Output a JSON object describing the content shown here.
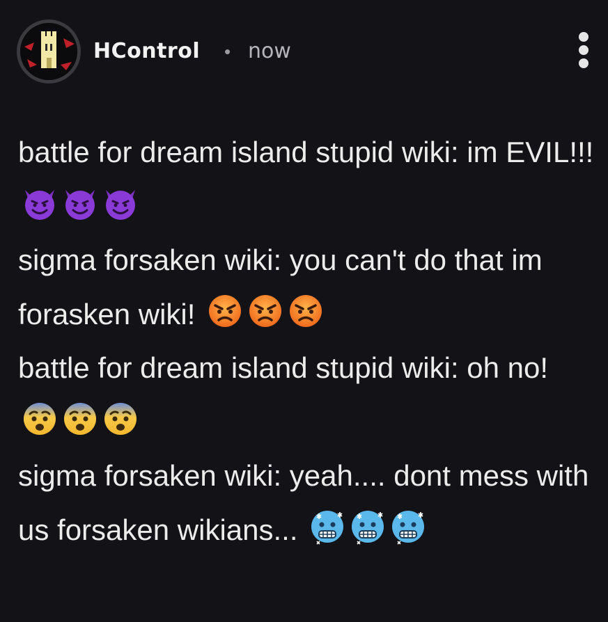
{
  "post": {
    "author": "HControl",
    "separator": "•",
    "time": "now",
    "avatar_icon": "castle-tower-icon",
    "menu_icon": "more-vertical-icon"
  },
  "content": {
    "lines": [
      {
        "text": "battle for dream island stupid wiki: im EVIL!!!",
        "emoji": "smiling-devil-emoji",
        "emoji_count": 3
      },
      {
        "text": "sigma forsaken wiki: you can't do that im forasken wiki!",
        "emoji": "angry-face-emoji",
        "emoji_count": 3
      },
      {
        "text": "battle for dream island stupid wiki: oh no!",
        "emoji": "fearful-face-emoji",
        "emoji_count": 3
      },
      {
        "text": "sigma forsaken wiki: yeah.... dont mess with us forsaken wikians...",
        "emoji": "cold-face-emoji",
        "emoji_count": 3
      }
    ]
  },
  "colors": {
    "background": "#121217",
    "text": "#ececec",
    "muted": "#b4b4ba"
  }
}
